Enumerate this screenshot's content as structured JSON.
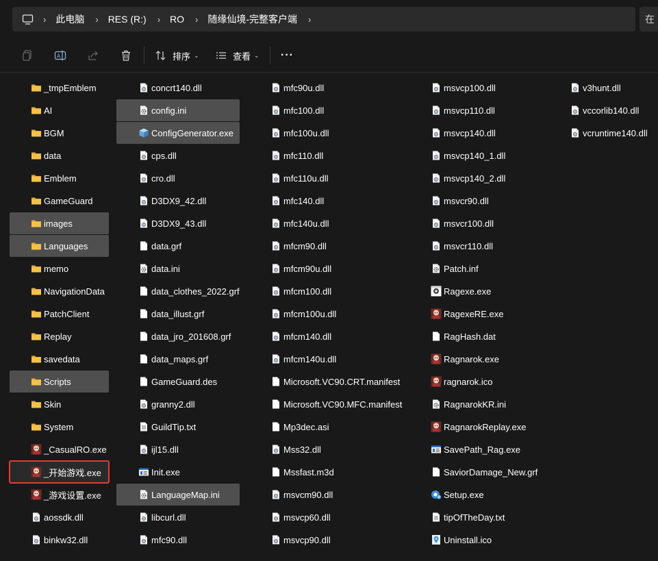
{
  "address": {
    "crumbs": [
      "此电脑",
      "RES (R:)",
      "RO",
      "随缘仙境-完整客户端"
    ],
    "search_stub": "在"
  },
  "toolbar": {
    "sort_label": "排序",
    "view_label": "查看",
    "more_label": "···"
  },
  "colors": {
    "folder": "#f3c24b",
    "selected_bg": "#4f4f4f",
    "highlight_border": "#e33b3b"
  },
  "columns": [
    {
      "items": [
        {
          "name": "_tmpEmblem",
          "icon": "folder-icon"
        },
        {
          "name": "AI",
          "icon": "folder-icon"
        },
        {
          "name": "BGM",
          "icon": "folder-icon"
        },
        {
          "name": "data",
          "icon": "folder-icon"
        },
        {
          "name": "Emblem",
          "icon": "folder-icon"
        },
        {
          "name": "GameGuard",
          "icon": "folder-icon"
        },
        {
          "name": "images",
          "icon": "folder-icon",
          "selected": true
        },
        {
          "name": "Languages",
          "icon": "folder-icon",
          "selected": true
        },
        {
          "name": "memo",
          "icon": "folder-icon"
        },
        {
          "name": "NavigationData",
          "icon": "folder-icon"
        },
        {
          "name": "PatchClient",
          "icon": "folder-icon"
        },
        {
          "name": "Replay",
          "icon": "folder-icon"
        },
        {
          "name": "savedata",
          "icon": "folder-icon"
        },
        {
          "name": "Scripts",
          "icon": "folder-icon",
          "selected": true
        },
        {
          "name": "Skin",
          "icon": "folder-icon"
        },
        {
          "name": "System",
          "icon": "folder-icon"
        },
        {
          "name": "_CasualRO.exe",
          "icon": "game-exe-icon"
        },
        {
          "name": "_开始游戏.exe",
          "icon": "game-exe-icon",
          "highlighted": true
        },
        {
          "name": "_游戏设置.exe",
          "icon": "game-exe-icon"
        },
        {
          "name": "aossdk.dll",
          "icon": "dll-icon"
        },
        {
          "name": "binkw32.dll",
          "icon": "dll-icon"
        }
      ]
    },
    {
      "items": [
        {
          "name": "concrt140.dll",
          "icon": "dll-icon"
        },
        {
          "name": "config.ini",
          "icon": "ini-icon",
          "selected": true
        },
        {
          "name": "ConfigGenerator.exe",
          "icon": "box-exe-icon",
          "selected": true
        },
        {
          "name": "cps.dll",
          "icon": "dll-icon"
        },
        {
          "name": "cro.dll",
          "icon": "dll-icon"
        },
        {
          "name": "D3DX9_42.dll",
          "icon": "dll-icon"
        },
        {
          "name": "D3DX9_43.dll",
          "icon": "dll-icon"
        },
        {
          "name": "data.grf",
          "icon": "file-icon"
        },
        {
          "name": "data.ini",
          "icon": "ini-icon"
        },
        {
          "name": "data_clothes_2022.grf",
          "icon": "file-icon"
        },
        {
          "name": "data_illust.grf",
          "icon": "file-icon"
        },
        {
          "name": "data_jro_201608.grf",
          "icon": "file-icon"
        },
        {
          "name": "data_maps.grf",
          "icon": "file-icon"
        },
        {
          "name": "GameGuard.des",
          "icon": "file-icon"
        },
        {
          "name": "granny2.dll",
          "icon": "dll-icon"
        },
        {
          "name": "GuildTip.txt",
          "icon": "txt-icon"
        },
        {
          "name": "ijl15.dll",
          "icon": "dll-icon"
        },
        {
          "name": "Init.exe",
          "icon": "app-exe-icon"
        },
        {
          "name": "LanguageMap.ini",
          "icon": "ini-icon",
          "selected": true
        },
        {
          "name": "libcurl.dll",
          "icon": "dll-icon"
        },
        {
          "name": "mfc90.dll",
          "icon": "dll-icon"
        }
      ]
    },
    {
      "items": [
        {
          "name": "mfc90u.dll",
          "icon": "dll-icon"
        },
        {
          "name": "mfc100.dll",
          "icon": "dll-icon"
        },
        {
          "name": "mfc100u.dll",
          "icon": "dll-icon"
        },
        {
          "name": "mfc110.dll",
          "icon": "dll-icon"
        },
        {
          "name": "mfc110u.dll",
          "icon": "dll-icon"
        },
        {
          "name": "mfc140.dll",
          "icon": "dll-icon"
        },
        {
          "name": "mfc140u.dll",
          "icon": "dll-icon"
        },
        {
          "name": "mfcm90.dll",
          "icon": "dll-icon"
        },
        {
          "name": "mfcm90u.dll",
          "icon": "dll-icon"
        },
        {
          "name": "mfcm100.dll",
          "icon": "dll-icon"
        },
        {
          "name": "mfcm100u.dll",
          "icon": "dll-icon"
        },
        {
          "name": "mfcm140.dll",
          "icon": "dll-icon"
        },
        {
          "name": "mfcm140u.dll",
          "icon": "dll-icon"
        },
        {
          "name": "Microsoft.VC90.CRT.manifest",
          "icon": "file-icon"
        },
        {
          "name": "Microsoft.VC90.MFC.manifest",
          "icon": "file-icon"
        },
        {
          "name": "Mp3dec.asi",
          "icon": "file-icon"
        },
        {
          "name": "Mss32.dll",
          "icon": "dll-icon"
        },
        {
          "name": "Mssfast.m3d",
          "icon": "file-icon"
        },
        {
          "name": "msvcm90.dll",
          "icon": "dll-icon"
        },
        {
          "name": "msvcp60.dll",
          "icon": "dll-icon"
        },
        {
          "name": "msvcp90.dll",
          "icon": "dll-icon"
        }
      ]
    },
    {
      "items": [
        {
          "name": "msvcp100.dll",
          "icon": "dll-icon"
        },
        {
          "name": "msvcp110.dll",
          "icon": "dll-icon"
        },
        {
          "name": "msvcp140.dll",
          "icon": "dll-icon"
        },
        {
          "name": "msvcp140_1.dll",
          "icon": "dll-icon"
        },
        {
          "name": "msvcp140_2.dll",
          "icon": "dll-icon"
        },
        {
          "name": "msvcr90.dll",
          "icon": "dll-icon"
        },
        {
          "name": "msvcr100.dll",
          "icon": "dll-icon"
        },
        {
          "name": "msvcr110.dll",
          "icon": "dll-icon"
        },
        {
          "name": "Patch.inf",
          "icon": "ini-icon"
        },
        {
          "name": "Ragexe.exe",
          "icon": "ragexe-icon"
        },
        {
          "name": "RagexeRE.exe",
          "icon": "game-exe-icon"
        },
        {
          "name": "RagHash.dat",
          "icon": "file-icon"
        },
        {
          "name": "Ragnarok.exe",
          "icon": "game-exe-icon"
        },
        {
          "name": "ragnarok.ico",
          "icon": "game-exe-icon"
        },
        {
          "name": "RagnarokKR.ini",
          "icon": "ini-icon"
        },
        {
          "name": "RagnarokReplay.exe",
          "icon": "game-exe-icon"
        },
        {
          "name": "SavePath_Rag.exe",
          "icon": "app-exe-icon"
        },
        {
          "name": "SaviorDamage_New.grf",
          "icon": "file-icon"
        },
        {
          "name": "Setup.exe",
          "icon": "setup-icon"
        },
        {
          "name": "tipOfTheDay.txt",
          "icon": "txt-icon"
        },
        {
          "name": "Uninstall.ico",
          "icon": "uninstall-icon"
        }
      ]
    },
    {
      "items": [
        {
          "name": "v3hunt.dll",
          "icon": "dll-icon"
        },
        {
          "name": "vccorlib140.dll",
          "icon": "dll-icon"
        },
        {
          "name": "vcruntime140.dll",
          "icon": "dll-icon"
        }
      ]
    }
  ]
}
